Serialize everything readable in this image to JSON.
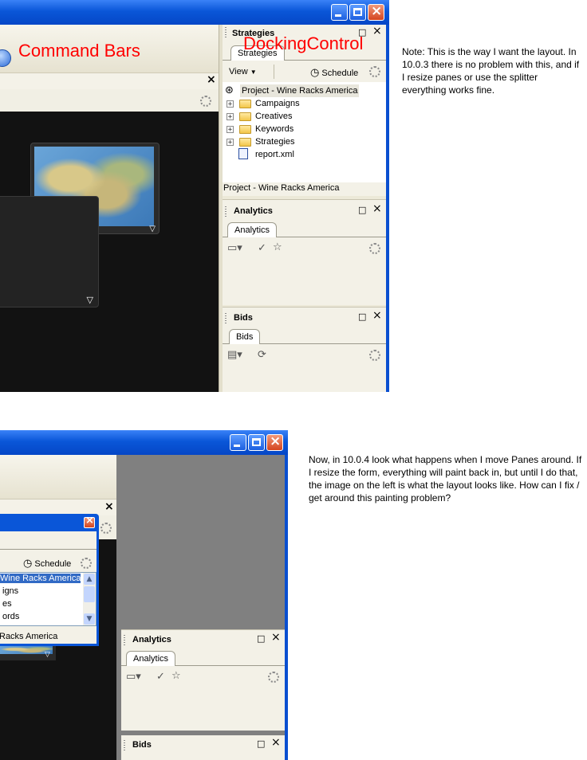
{
  "top": {
    "command_bars_label": "Command Bars",
    "docking_control_label": "DockingControl",
    "strategies_pane": {
      "title": "Strategies",
      "tab": "Strategies",
      "view_label": "View",
      "schedule_label": "Schedule",
      "tree": [
        {
          "label": "Project - Wine Racks America",
          "type": "root"
        },
        {
          "label": "Campaigns",
          "type": "folder"
        },
        {
          "label": "Creatives",
          "type": "folder"
        },
        {
          "label": "Keywords",
          "type": "folder"
        },
        {
          "label": "Strategies",
          "type": "folder"
        },
        {
          "label": "report.xml",
          "type": "file"
        }
      ],
      "status": "Project - Wine Racks America"
    },
    "analytics_pane": {
      "title": "Analytics",
      "tab": "Analytics"
    },
    "bids_pane": {
      "title": "Bids",
      "tab": "Bids"
    },
    "close_glyph": "×",
    "max_glyph": "□",
    "note": "Note: This is the way I want the layout. In 10.0.3 there is no problem with this, and if I resize panes or use the splitter everything works fine."
  },
  "bottom": {
    "floating": {
      "schedule_label": "Schedule",
      "rows": [
        "Wine Racks America",
        "igns",
        "es",
        "ords"
      ],
      "status": "Racks America"
    },
    "analytics_pane": {
      "title": "Analytics",
      "tab": "Analytics"
    },
    "bids_pane": {
      "title": "Bids"
    },
    "note": "Now, in 10.0.4 look what happens when I move Panes around. If I resize the form, everything will paint back in, but until I do that, the image on the left is what the layout looks like. How can I fix / get around this painting problem?"
  },
  "colors": {
    "xp_blue": "#0a56d8",
    "pane_bg": "#f3f1e7",
    "red_label": "#ff0000"
  }
}
